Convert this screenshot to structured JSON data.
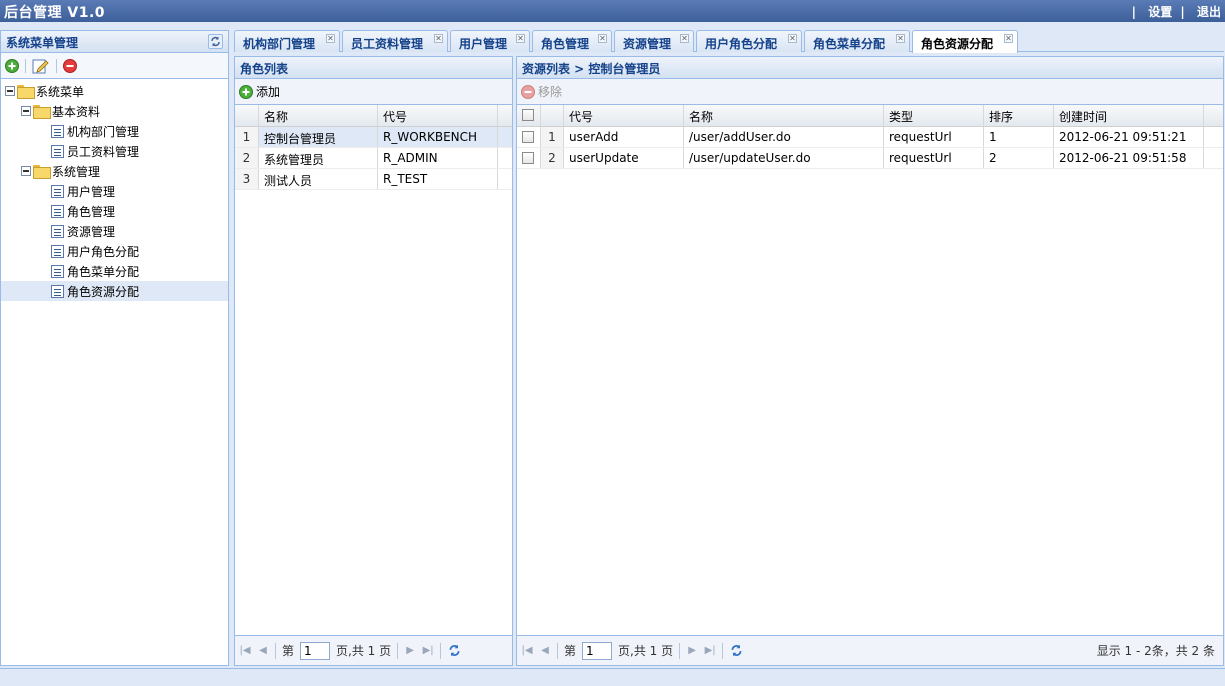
{
  "app": {
    "title": "后台管理 V1.0",
    "settings": "设置",
    "logout": "退出",
    "sep": "|"
  },
  "sidebar": {
    "title": "系统菜单管理",
    "root": "系统菜单",
    "groups": [
      {
        "label": "基本资料",
        "items": [
          "机构部门管理",
          "员工资料管理"
        ]
      },
      {
        "label": "系统管理",
        "items": [
          "用户管理",
          "角色管理",
          "资源管理",
          "用户角色分配",
          "角色菜单分配",
          "角色资源分配"
        ]
      }
    ]
  },
  "tabs": [
    "机构部门管理",
    "员工资料管理",
    "用户管理",
    "角色管理",
    "资源管理",
    "用户角色分配",
    "角色菜单分配",
    "角色资源分配"
  ],
  "roles": {
    "title": "角色列表",
    "add": "添加",
    "headers": [
      "名称",
      "代号"
    ],
    "rows": [
      {
        "n": "1",
        "name": "控制台管理员",
        "code": "R_WORKBENCH"
      },
      {
        "n": "2",
        "name": "系统管理员",
        "code": "R_ADMIN"
      },
      {
        "n": "3",
        "name": "测试人员",
        "code": "R_TEST"
      }
    ]
  },
  "resources": {
    "title": "资源列表 > 控制台管理员",
    "remove": "移除",
    "headers": [
      "代号",
      "名称",
      "类型",
      "排序",
      "创建时间"
    ],
    "rows": [
      {
        "n": "1",
        "code": "userAdd",
        "name": "/user/addUser.do",
        "type": "requestUrl",
        "order": "1",
        "created": "2012-06-21 09:51:21"
      },
      {
        "n": "2",
        "code": "userUpdate",
        "name": "/user/updateUser.do",
        "type": "requestUrl",
        "order": "2",
        "created": "2012-06-21 09:51:58"
      }
    ]
  },
  "pager": {
    "page_prefix": "第",
    "page_value": "1",
    "page_suffix": "页,共 1 页",
    "summary": "显示 1 - 2条，共 2 条"
  }
}
